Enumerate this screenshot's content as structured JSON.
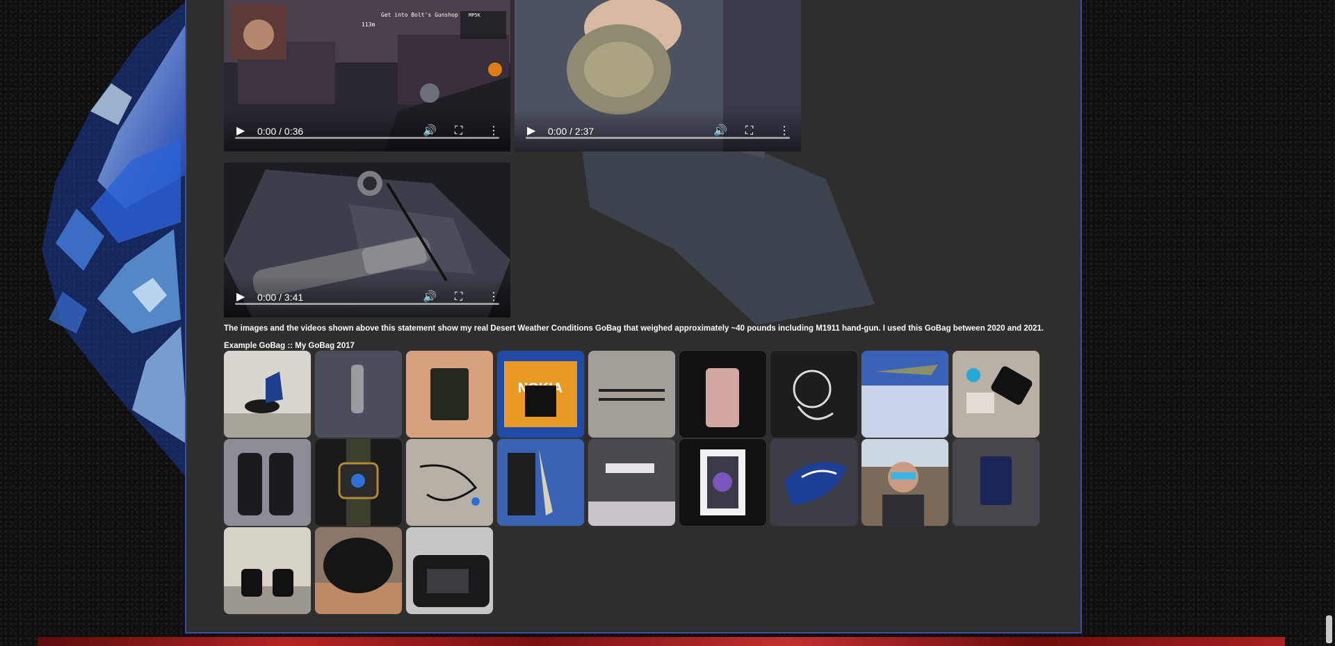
{
  "videos": [
    {
      "time": "0:00 / 0:36"
    },
    {
      "time": "0:00 / 2:37"
    },
    {
      "time": "0:00 / 3:41"
    }
  ],
  "video1_overlay": {
    "objective": "Get into Bolt's Gunshop",
    "distance": "113m",
    "weapon": "MP5K"
  },
  "caption": "The images and the videos shown above this statement show my real Desert Weather Conditions GoBag that weighed approximately ~40 pounds including M1911 hand-gun. I used this GoBag between 2020 and 2021.",
  "gallery": {
    "title": "Example GoBag :: My GoBag 2017",
    "tile_labels": {
      "nokia": "NOKIA"
    }
  },
  "icons": {
    "play": "play-icon",
    "volume": "volume-icon",
    "fullscreen": "fullscreen-icon",
    "more": "more-vertical-icon"
  },
  "colors": {
    "panel_bg": "#2e2e2e",
    "panel_border": "#3c4fa3",
    "text": "#ffffff",
    "footer": "#b52424"
  }
}
